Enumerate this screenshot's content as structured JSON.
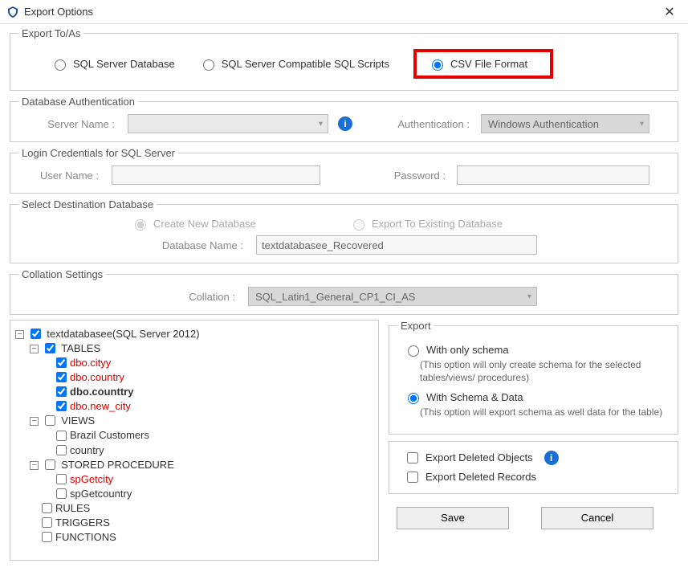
{
  "window": {
    "title": "Export Options"
  },
  "exportTo": {
    "legend": "Export To/As",
    "options": {
      "sqlServer": "SQL Server Database",
      "sqlScripts": "SQL Server Compatible SQL Scripts",
      "csv": "CSV File Format"
    },
    "selected": "csv"
  },
  "dbAuth": {
    "legend": "Database Authentication",
    "serverNameLabel": "Server Name :",
    "serverName": "",
    "authLabel": "Authentication :",
    "authValue": "Windows Authentication"
  },
  "login": {
    "legend": "Login Credentials for SQL Server",
    "userLabel": "User Name :",
    "userValue": "",
    "passLabel": "Password :",
    "passValue": ""
  },
  "destDb": {
    "legend": "Select Destination Database",
    "createNew": "Create New Database",
    "exportExisting": "Export To Existing Database",
    "dbNameLabel": "Database Name :",
    "dbNameValue": "textdatabasee_Recovered"
  },
  "collation": {
    "legend": "Collation Settings",
    "label": "Collation :",
    "value": "SQL_Latin1_General_CP1_CI_AS"
  },
  "tree": {
    "root": "textdatabasee(SQL Server 2012)",
    "groups": {
      "tables": "TABLES",
      "views": "VIEWS",
      "sp": "STORED PROCEDURE",
      "rules": "RULES",
      "triggers": "TRIGGERS",
      "functions": "FUNCTIONS"
    },
    "tables": [
      "dbo.cityy",
      "dbo.country",
      "dbo.counttry",
      "dbo.new_city"
    ],
    "views": [
      "Brazil Customers",
      "country"
    ],
    "sps": [
      "spGetcity",
      "spGetcountry"
    ]
  },
  "exportOpts": {
    "legend": "Export",
    "schemaOnly": "With only schema",
    "schemaOnlyNote": "(This option will only create schema for the  selected tables/views/ procedures)",
    "schemaData": "With Schema & Data",
    "schemaDataNote": "(This option will export schema as well data for the table)",
    "delObjects": "Export Deleted Objects",
    "delRecords": "Export Deleted Records"
  },
  "buttons": {
    "save": "Save",
    "cancel": "Cancel"
  }
}
